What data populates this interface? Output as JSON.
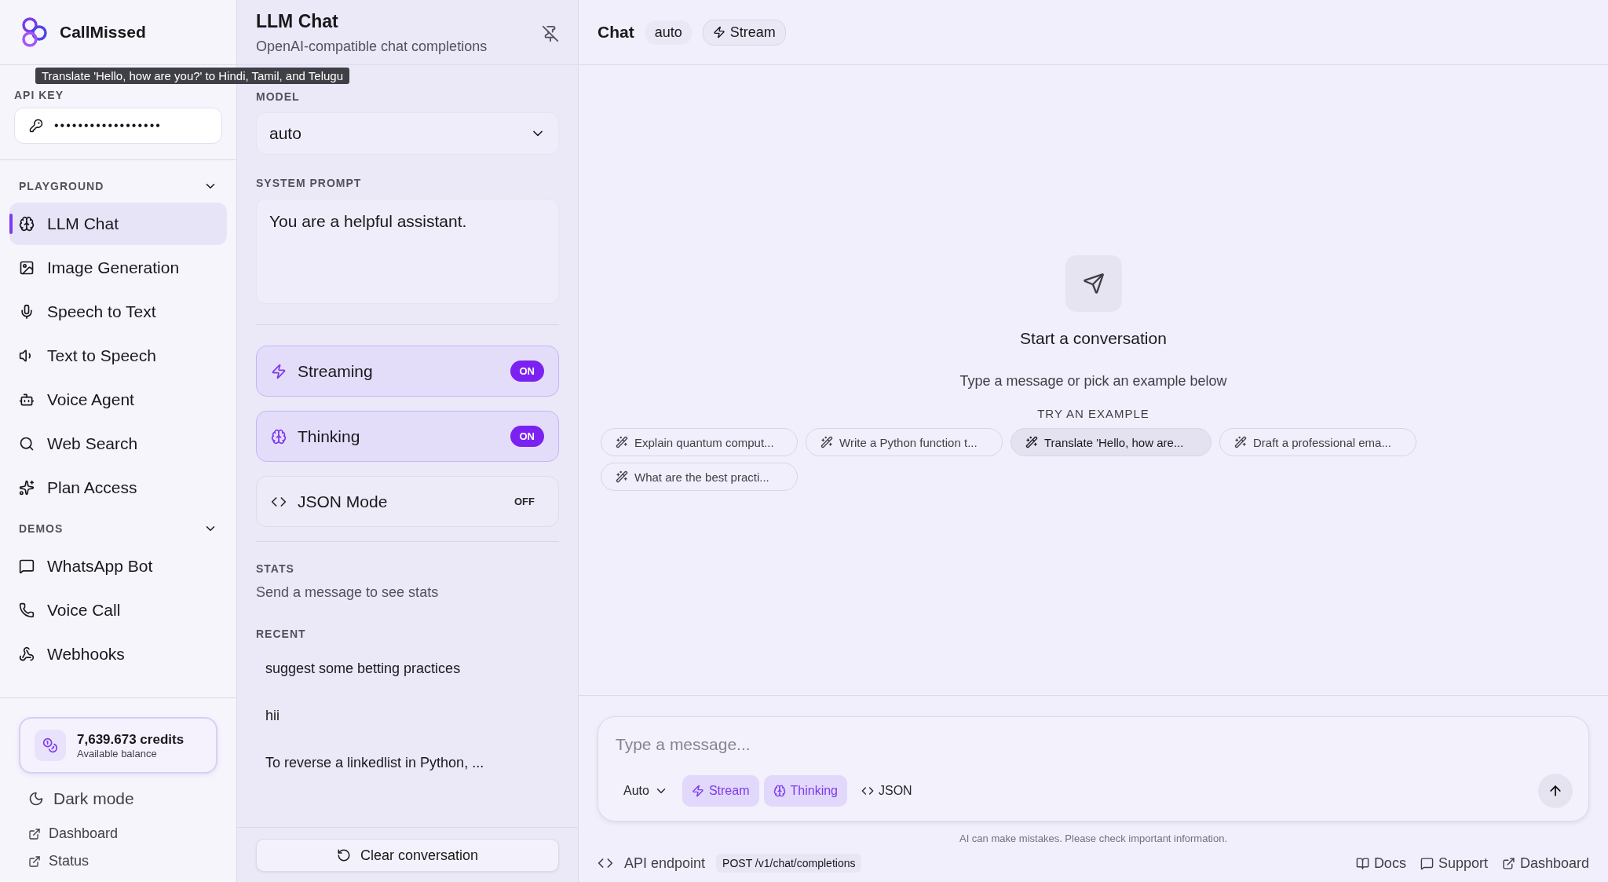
{
  "brand": {
    "name": "CallMissed"
  },
  "tooltip": "Translate 'Hello, how are you?' to Hindi, Tamil, and Telugu",
  "api_key": {
    "label": "API KEY",
    "value": "••••••••••••••••••"
  },
  "sidebar": {
    "sections": [
      {
        "title": "PLAYGROUND",
        "expanded": true,
        "items": [
          {
            "label": "LLM Chat",
            "selected": true
          },
          {
            "label": "Image Generation",
            "selected": false
          },
          {
            "label": "Speech to Text",
            "selected": false
          },
          {
            "label": "Text to Speech",
            "selected": false
          },
          {
            "label": "Voice Agent",
            "selected": false
          },
          {
            "label": "Web Search",
            "selected": false
          },
          {
            "label": "Plan Access",
            "selected": false
          }
        ]
      },
      {
        "title": "DEMOS",
        "expanded": true,
        "items": [
          {
            "label": "WhatsApp Bot",
            "selected": false
          },
          {
            "label": "Voice Call",
            "selected": false
          },
          {
            "label": "Webhooks",
            "selected": false
          }
        ]
      }
    ]
  },
  "credits": {
    "amount": "7,639.673 credits",
    "caption": "Available balance"
  },
  "theme_toggle": "Dark mode",
  "sidebar_links": [
    "Dashboard",
    "Status"
  ],
  "settings": {
    "title": "LLM Chat",
    "subtitle": "OpenAI-compatible chat completions",
    "model_label": "MODEL",
    "model": "auto",
    "prompt_label": "SYSTEM PROMPT",
    "prompt": "You are a helpful assistant.",
    "toggles": [
      {
        "label": "Streaming",
        "on": true,
        "state_text": "ON"
      },
      {
        "label": "Thinking",
        "on": true,
        "state_text": "ON"
      },
      {
        "label": "JSON Mode",
        "on": false,
        "state_text": "OFF"
      }
    ],
    "stats_label": "STATS",
    "stats_text": "Send a message to see stats",
    "recent_label": "RECENT",
    "recent": [
      "suggest some betting practices",
      "hii",
      "To reverse a linkedlist in Python, ..."
    ],
    "clear_button": "Clear conversation"
  },
  "chat": {
    "title": "Chat",
    "model_badge": "auto",
    "stream_badge": "Stream",
    "empty_title": "Start a conversation",
    "empty_text": "Type a message or pick an example below",
    "examples_label": "TRY AN EXAMPLE",
    "examples": [
      {
        "label": "Explain quantum comput...",
        "hovered": false
      },
      {
        "label": "Write a Python function t...",
        "hovered": false
      },
      {
        "label": "Translate 'Hello, how are...",
        "hovered": true
      },
      {
        "label": "Draft a professional ema...",
        "hovered": false
      },
      {
        "label": "What are the best practi...",
        "hovered": false
      }
    ],
    "input": {
      "placeholder": "Type a message...",
      "model": "Auto",
      "options": [
        {
          "label": "Stream",
          "on": true
        },
        {
          "label": "Thinking",
          "on": true
        },
        {
          "label": "JSON",
          "on": false
        }
      ]
    },
    "disclaimer": "AI can make mistakes. Please check important information.",
    "footer": {
      "endpoint_label": "API endpoint",
      "endpoint": "POST /v1/chat/completions",
      "links": [
        "Docs",
        "Support",
        "Dashboard"
      ]
    }
  }
}
